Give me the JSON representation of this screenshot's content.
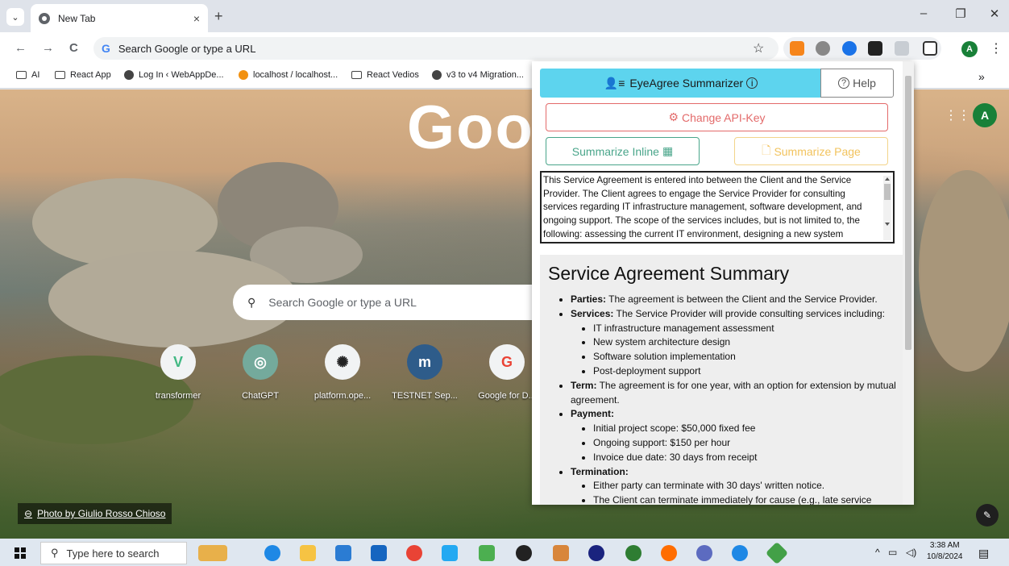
{
  "browser": {
    "tab_title": "New Tab",
    "tab_close": "×",
    "new_tab": "+",
    "window_controls": {
      "minimize": "–",
      "restore": "❐",
      "close": "✕"
    },
    "nav": {
      "back": "←",
      "forward": "→",
      "reload": "C"
    },
    "omnibox_placeholder": "Search Google or type a URL",
    "bookmarks": [
      "AI",
      "React App",
      "Log In ‹ WebAppDe...",
      "localhost / localhost...",
      "React Vedios",
      "v3 to v4 Migration..."
    ],
    "bookmarks_more": "»",
    "profile_initial": "A",
    "kebab": "⋮",
    "star": "☆"
  },
  "ntp": {
    "logo_partial": "Goo",
    "search_placeholder": "Search Google or type a URL",
    "shortcuts": [
      {
        "label": "transformer",
        "glyph": "V",
        "color": "#41b883"
      },
      {
        "label": "ChatGPT",
        "glyph": "◎",
        "color": "#74aa9c"
      },
      {
        "label": "platform.ope...",
        "glyph": "✺",
        "color": "#222222"
      },
      {
        "label": "TESTNET Sep...",
        "glyph": "m",
        "color": "#2e5c8a"
      },
      {
        "label": "Google for D...",
        "glyph": "G",
        "color": "#ea4335"
      }
    ],
    "photo_credit": "Photo by Giulio Rosso Chioso",
    "profile_initial": "A"
  },
  "popup": {
    "title": "EyeAgree Summarizer",
    "help": "Help",
    "change_api_key": "Change API-Key",
    "summarize_inline": "Summarize Inline",
    "summarize_page": "Summarize Page",
    "agreement_text": "This Service Agreement is entered into between the Client and the Service Provider. The Client agrees to engage the Service Provider for consulting services regarding IT infrastructure management, software development, and ongoing support. The scope of the services includes, but is not limited to, the following: assessing the current IT environment, designing a new system",
    "summary": {
      "heading": "Service Agreement Summary",
      "parties_label": "Parties:",
      "parties_text": " The agreement is between the Client and the Service Provider.",
      "services_label": "Services:",
      "services_text": " The Service Provider will provide consulting services including:",
      "services_items": [
        "IT infrastructure management assessment",
        "New system architecture design",
        "Software solution implementation",
        "Post-deployment support"
      ],
      "term_label": "Term:",
      "term_text": " The agreement is for one year, with an option for extension by mutual agreement.",
      "payment_label": "Payment:",
      "payment_items": [
        "Initial project scope: $50,000 fixed fee",
        "Ongoing support: $150 per hour",
        "Invoice due date: 30 days from receipt"
      ],
      "termination_label": "Termination:",
      "termination_items": [
        "Either party can terminate with 30 days' written notice.",
        "The Client can terminate immediately for cause (e.g., late service"
      ]
    }
  },
  "taskbar": {
    "search_placeholder": "Type here to search",
    "time": "3:38 AM",
    "date": "10/8/2024",
    "tray_up": "^"
  }
}
